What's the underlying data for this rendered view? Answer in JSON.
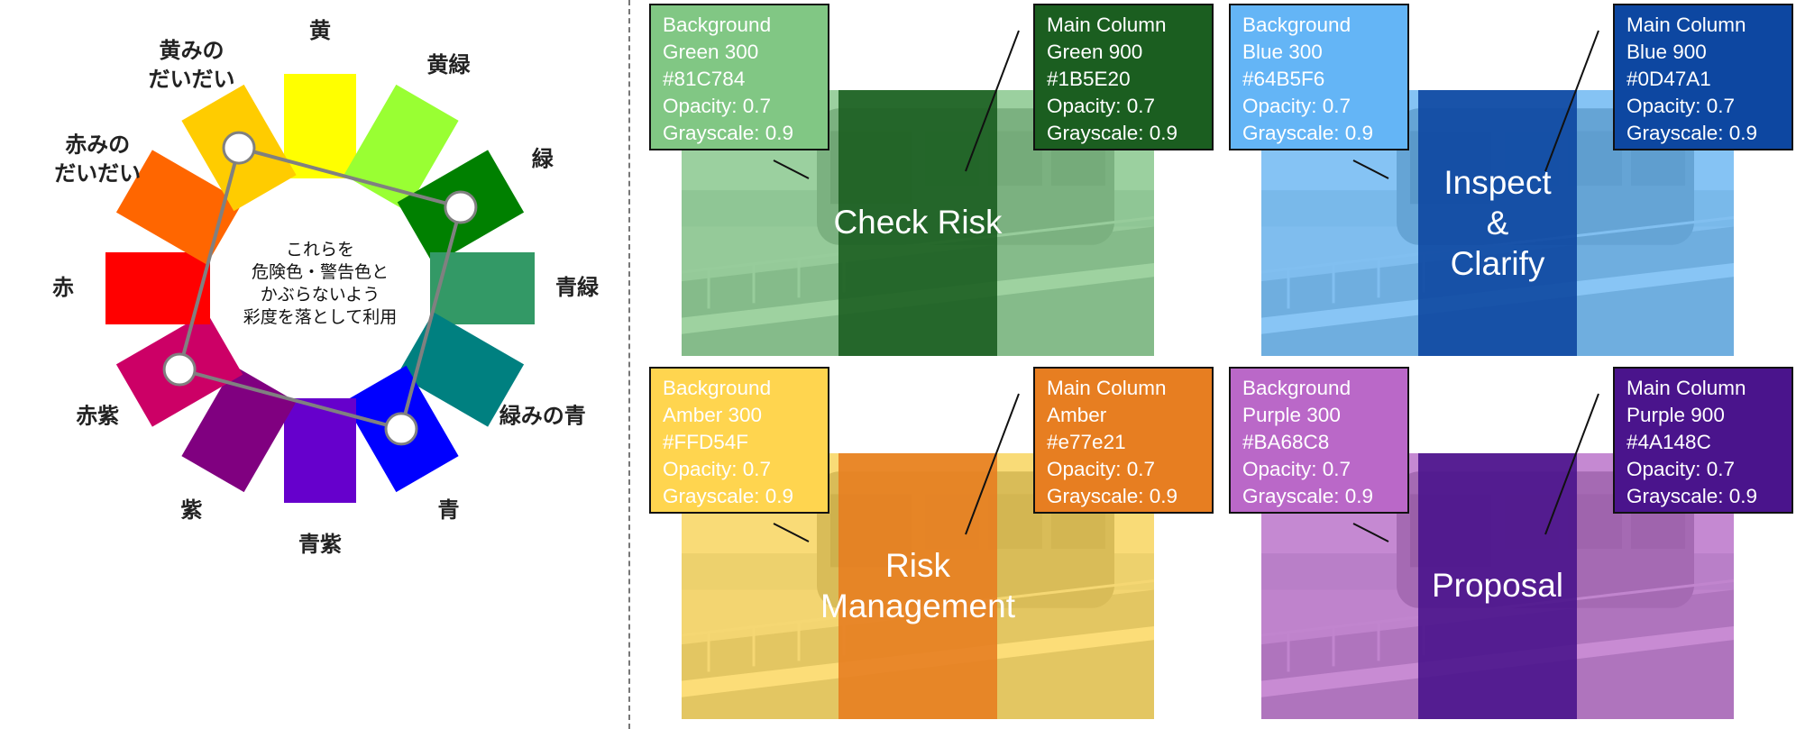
{
  "wheel": {
    "center_text": [
      "これらを",
      "危険色・警告色と",
      "かぶらないよう",
      "彩度を落として利用"
    ],
    "segments": [
      {
        "label": "黄",
        "color": "#FFFF00"
      },
      {
        "label": "黄緑",
        "color": "#99FF33"
      },
      {
        "label": "緑",
        "color": "#008000"
      },
      {
        "label": "青緑",
        "color": "#339966"
      },
      {
        "label": "緑みの青",
        "color": "#008080"
      },
      {
        "label": "青",
        "color": "#0000FF"
      },
      {
        "label": "青紫",
        "color": "#6600CC"
      },
      {
        "label": "紫",
        "color": "#800080"
      },
      {
        "label": "赤紫",
        "color": "#CC0066"
      },
      {
        "label": "赤",
        "color": "#FF0000"
      },
      {
        "label": "赤みのだいだい",
        "label_lines": [
          "赤みの",
          "だいだい"
        ],
        "color": "#FF6600"
      },
      {
        "label": "黄みのだいだい",
        "label_lines": [
          "黄みの",
          "だいだい"
        ],
        "color": "#FFCC00"
      }
    ],
    "selected_segments": [
      "黄みのだいだい",
      "緑",
      "青",
      "赤紫"
    ]
  },
  "panels": [
    {
      "title": [
        "Check Risk"
      ],
      "background": {
        "lines": [
          "Background",
          "Green 300",
          "#81C784",
          "Opacity: 0.7",
          "Grayscale: 0.9"
        ],
        "color": "#81C784"
      },
      "main": {
        "lines": [
          "Main Column",
          "Green 900",
          "#1B5E20",
          "Opacity: 0.7",
          "Grayscale: 0.9"
        ],
        "color": "#1B5E20"
      }
    },
    {
      "title": [
        "Inspect",
        "&",
        "Clarify"
      ],
      "background": {
        "lines": [
          "Background",
          "Blue 300",
          "#64B5F6",
          "Opacity: 0.7",
          "Grayscale: 0.9"
        ],
        "color": "#64B5F6"
      },
      "main": {
        "lines": [
          "Main Column",
          "Blue 900",
          "#0D47A1",
          "Opacity: 0.7",
          "Grayscale: 0.9"
        ],
        "color": "#0D47A1"
      }
    },
    {
      "title": [
        "Risk",
        "Management"
      ],
      "background": {
        "lines": [
          "Background",
          "Amber 300",
          "#FFD54F",
          "Opacity: 0.7",
          "Grayscale: 0.9"
        ],
        "color": "#FFD54F"
      },
      "main": {
        "lines": [
          "Main Column",
          "Amber",
          "#e77e21",
          "Opacity: 0.7",
          "Grayscale: 0.9"
        ],
        "color": "#e77e21"
      }
    },
    {
      "title": [
        "Proposal"
      ],
      "background": {
        "lines": [
          "Background",
          "Purple 300",
          "#BA68C8",
          "Opacity: 0.7",
          "Grayscale: 0.9"
        ],
        "color": "#BA68C8"
      },
      "main": {
        "lines": [
          "Main Column",
          "Purple 900",
          "#4A148C",
          "Opacity: 0.7",
          "Grayscale: 0.9"
        ],
        "color": "#4A148C"
      }
    }
  ]
}
